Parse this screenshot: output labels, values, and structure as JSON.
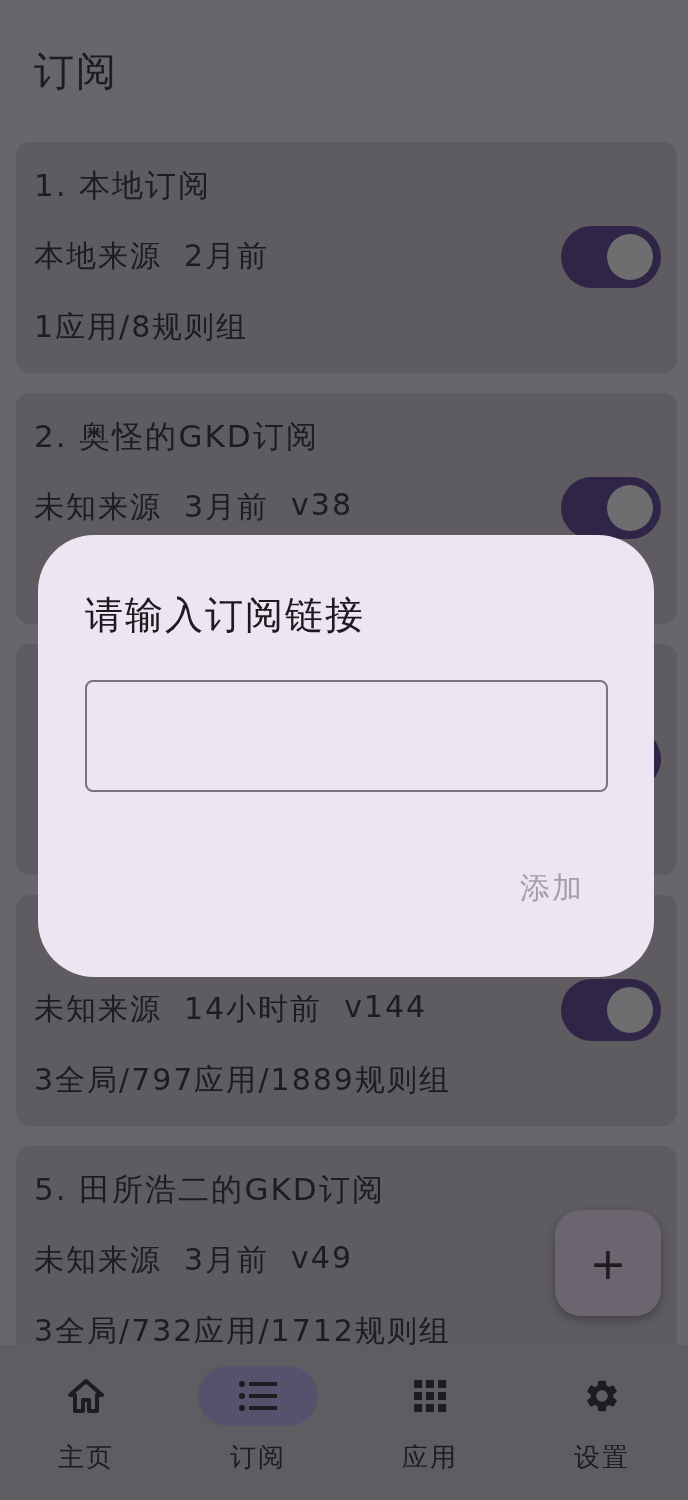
{
  "header": {
    "title": "订阅"
  },
  "subscriptions": [
    {
      "title": "1. 本地订阅",
      "meta": [
        "本地来源",
        "2月前"
      ],
      "stats": "1应用/8规则组",
      "enabled": true
    },
    {
      "title": "2. 奥怪的GKD订阅",
      "meta": [
        "未知来源",
        "3月前",
        "v38"
      ],
      "enabled": true
    },
    {
      "enabled": true
    },
    {
      "meta": [
        "未知来源",
        "14小时前",
        "v144"
      ],
      "stats": "3全局/797应用/1889规则组",
      "enabled": true
    },
    {
      "title": "5. 田所浩二的GKD订阅",
      "meta": [
        "未知来源",
        "3月前",
        "v49"
      ],
      "stats": "3全局/732应用/1712规则组"
    }
  ],
  "fab": {
    "label": "+"
  },
  "nav": [
    {
      "label": "主页",
      "selected": false
    },
    {
      "label": "订阅",
      "selected": true
    },
    {
      "label": "应用",
      "selected": false
    },
    {
      "label": "设置",
      "selected": false
    }
  ],
  "dialog": {
    "title": "请输入订阅链接",
    "button": {
      "label": "添加",
      "disabled": true
    }
  }
}
